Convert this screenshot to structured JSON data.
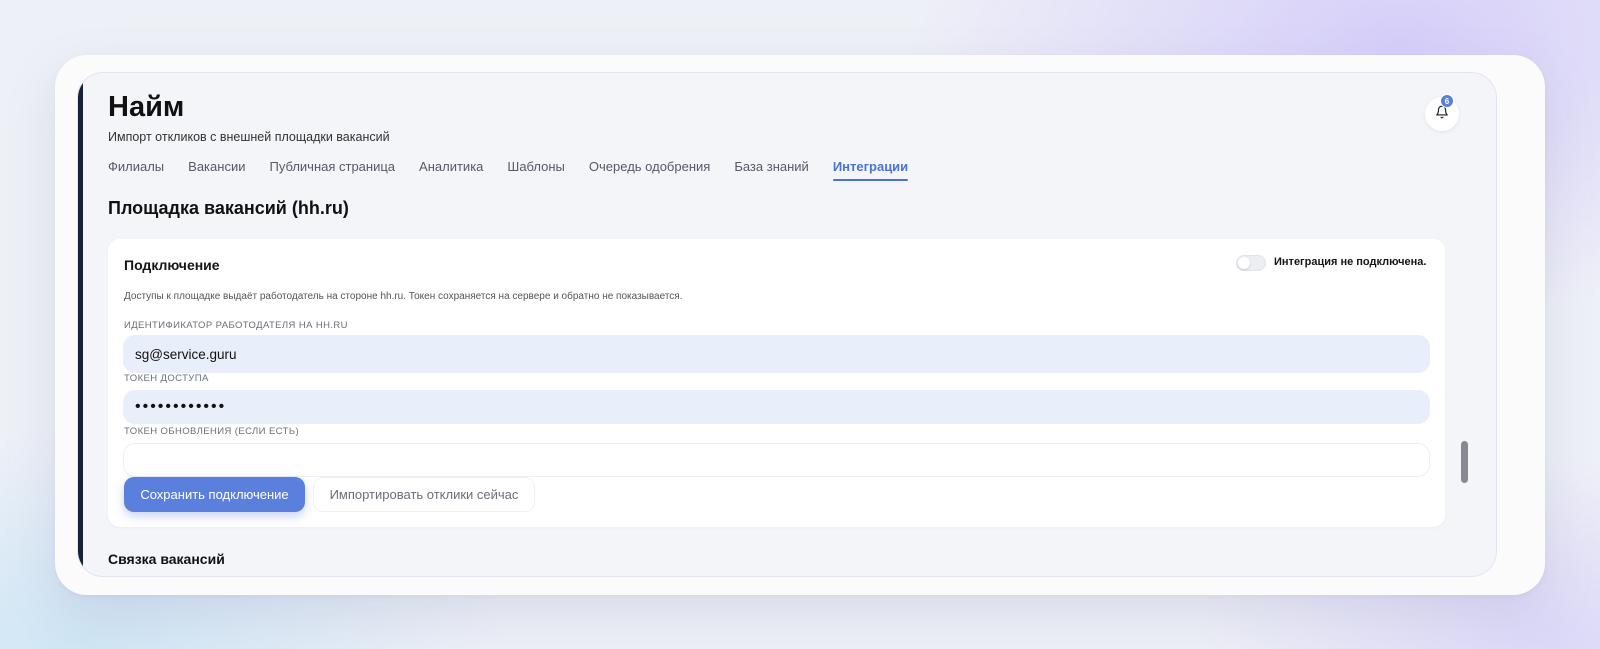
{
  "header": {
    "title": "Найм",
    "subtitle": "Импорт откликов с внешней площадки вакансий",
    "notifications_count": "6"
  },
  "tabs": [
    {
      "label": "Филиалы",
      "active": false
    },
    {
      "label": "Вакансии",
      "active": false
    },
    {
      "label": "Публичная страница",
      "active": false
    },
    {
      "label": "Аналитика",
      "active": false
    },
    {
      "label": "Шаблоны",
      "active": false
    },
    {
      "label": "Очередь одобрения",
      "active": false
    },
    {
      "label": "База знаний",
      "active": false
    },
    {
      "label": "Интеграции",
      "active": true
    }
  ],
  "section": {
    "title": "Площадка вакансий (hh.ru)"
  },
  "connection": {
    "title": "Подключение",
    "status": "Интеграция не подключена.",
    "enabled": false,
    "description": "Доступы к площадке выдаёт работодатель на стороне hh.ru. Токен сохраняется на сервере и обратно не показывается.",
    "employer_id_label": "ИДЕНТИФИКАТОР РАБОТОДАТЕЛЯ НА HH.RU",
    "employer_id_value": "sg@service.guru",
    "token_label": "ТОКЕН ДОСТУПА",
    "token_value": "••••••••••••",
    "refresh_token_label": "ТОКЕН ОБНОВЛЕНИЯ (ЕСЛИ ЕСТЬ)",
    "refresh_token_value": "",
    "save_label": "Сохранить подключение",
    "import_label": "Импортировать отклики сейчас"
  },
  "next_section": {
    "title": "Связка вакансий"
  },
  "colors": {
    "accent": "#5b7fdc",
    "active_tab": "#4b73d6",
    "input_fill": "#e9eefb",
    "sidebar_bar": "#16213a"
  }
}
